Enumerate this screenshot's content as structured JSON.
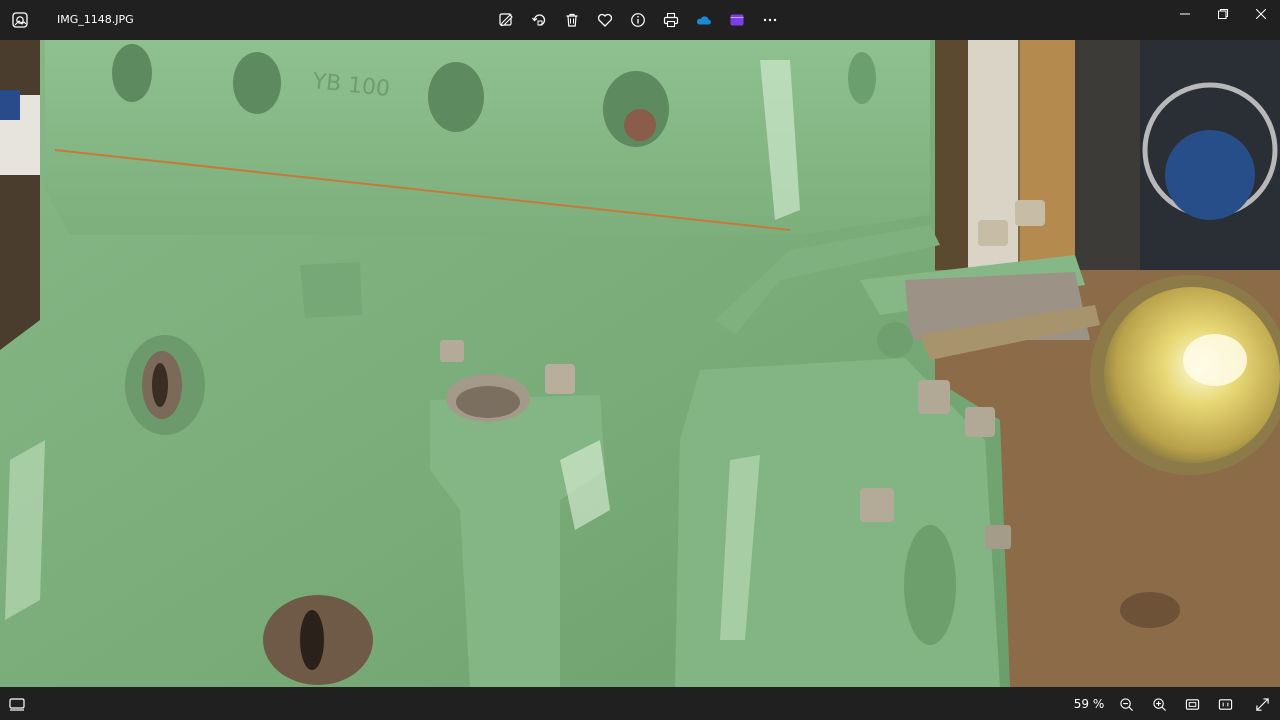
{
  "window": {
    "title": "IMG_1148.JPG",
    "controls": [
      "minimize-icon",
      "maximize-icon",
      "close-icon"
    ]
  },
  "toolbar": {
    "buttons": [
      "edit-image-icon",
      "rotate-icon",
      "delete-icon",
      "favorite-icon",
      "info-icon",
      "print-icon",
      "onedrive-icon",
      "clipchamp-icon",
      "more-options-icon"
    ]
  },
  "photo": {
    "subject": "green engine block",
    "casting_text": "YB 100"
  },
  "statusbar": {
    "zoom": "59 %",
    "buttons": [
      "filmstrip-icon",
      "zoom-out-icon",
      "zoom-in-icon",
      "fit-to-window-icon",
      "actual-size-icon",
      "fullscreen-icon"
    ]
  },
  "colors": {
    "chrome": "#202020",
    "engine_green": "#8ab88a",
    "onedrive": "#1a8ad4",
    "clipchamp": "#7b3fe4"
  }
}
